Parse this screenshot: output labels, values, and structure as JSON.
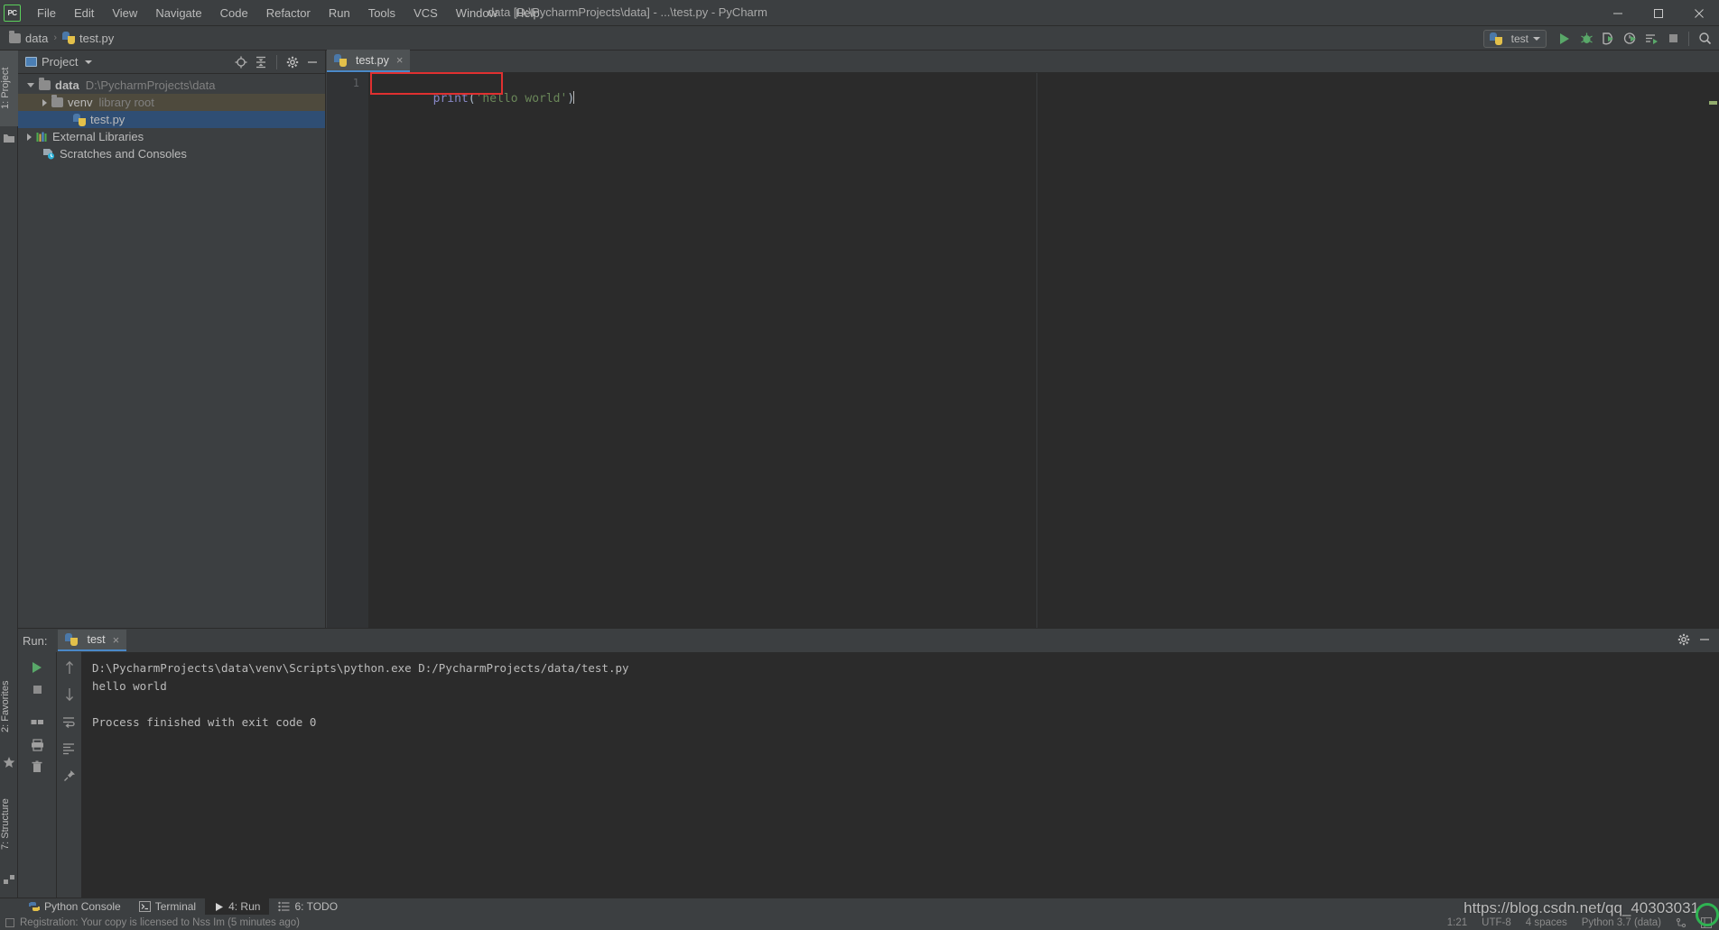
{
  "window": {
    "title": "data [D:\\PycharmProjects\\data] - ...\\test.py - PyCharm",
    "logo_text": "PC",
    "minimize": "—",
    "maximize": "❐",
    "close": "✕"
  },
  "menubar": {
    "items": [
      {
        "label": "File",
        "mnemonic": "F"
      },
      {
        "label": "Edit",
        "mnemonic": "E"
      },
      {
        "label": "View",
        "mnemonic": "V"
      },
      {
        "label": "Navigate",
        "mnemonic": "N"
      },
      {
        "label": "Code",
        "mnemonic": "C"
      },
      {
        "label": "Refactor",
        "mnemonic": "R"
      },
      {
        "label": "Run",
        "mnemonic": "u"
      },
      {
        "label": "Tools",
        "mnemonic": "T"
      },
      {
        "label": "VCS",
        "mnemonic": "S"
      },
      {
        "label": "Window",
        "mnemonic": "W"
      },
      {
        "label": "Help",
        "mnemonic": "H"
      }
    ]
  },
  "breadcrumb": {
    "root": "data",
    "separator": "›",
    "file": "test.py"
  },
  "run_widget": {
    "config_name": "test",
    "buttons": [
      "run-button",
      "debug-button",
      "run-coverage-button",
      "profile-button",
      "run-with-console-button",
      "stop-button",
      "search-button"
    ]
  },
  "left_strip": {
    "tabs": [
      {
        "label": "1: Project",
        "selected": true
      },
      {
        "label": "2: Favorites",
        "selected": false
      },
      {
        "label": "7: Structure",
        "selected": false
      }
    ]
  },
  "project_panel": {
    "title": "Project",
    "header_icons": [
      "locate-icon",
      "collapse-all-icon",
      "settings-icon",
      "hide-icon"
    ],
    "tree": [
      {
        "name": "data",
        "detail": "D:\\PycharmProjects\\data",
        "arrow": "down",
        "icon": "folder-icon",
        "bold": true,
        "indent": 0,
        "highlight": "none"
      },
      {
        "name": "venv",
        "detail": "library root",
        "arrow": "right",
        "icon": "folder-excluded-icon",
        "bold": false,
        "indent": 1,
        "highlight": "olive"
      },
      {
        "name": "test.py",
        "detail": "",
        "arrow": "none",
        "icon": "python-file-icon",
        "bold": false,
        "indent": 2,
        "highlight": "blue"
      },
      {
        "name": "External Libraries",
        "detail": "",
        "arrow": "right",
        "icon": "libraries-icon",
        "bold": false,
        "indent": 0,
        "highlight": "none"
      },
      {
        "name": "Scratches and Consoles",
        "detail": "",
        "arrow": "none",
        "icon": "scratches-icon",
        "bold": false,
        "indent": 0,
        "highlight": "none"
      }
    ]
  },
  "editor": {
    "tab_label": "test.py",
    "tab_close": "×",
    "line_number": "1",
    "code": {
      "fn": "print",
      "open_paren": "(",
      "string": "'hello world'",
      "close_paren": ")"
    },
    "annotation": "red-highlight-box"
  },
  "run_tool": {
    "label": "Run:",
    "tab_name": "test",
    "tab_close": "×",
    "header_icons": [
      "settings-icon",
      "hide-icon"
    ],
    "sidebar_icons": [
      "rerun-icon",
      "stop-icon",
      "layout-icon",
      "print-icon",
      "trash-icon",
      "up-arrow-icon",
      "down-arrow-icon",
      "soft-wrap-icon",
      "scroll-to-end-icon",
      "pin-icon"
    ],
    "console_lines": [
      "D:\\PycharmProjects\\data\\venv\\Scripts\\python.exe D:/PycharmProjects/data/test.py",
      "hello world",
      "",
      "Process finished with exit code 0"
    ]
  },
  "bottom_bar": {
    "tabs": [
      {
        "label": "Python Console",
        "mnemonic": "",
        "icon": "python-console-icon",
        "active": false
      },
      {
        "label": "Terminal",
        "mnemonic": "",
        "icon": "terminal-icon",
        "active": false
      },
      {
        "label": "4: Run",
        "mnemonic": "4",
        "icon": "run-icon",
        "active": true
      },
      {
        "label": "6: TODO",
        "mnemonic": "6",
        "icon": "todo-icon",
        "active": false
      }
    ]
  },
  "status_bar": {
    "message": "Registration: Your copy is licensed to Nss Im (5 minutes ago)",
    "caret_position": "1:21",
    "encoding": "UTF-8",
    "indent": "4 spaces",
    "interpreter": "Python 3.7 (data)"
  },
  "watermark": {
    "text": "https://blog.csdn.net/qq_40303031"
  },
  "colors": {
    "background": "#3c3f41",
    "editor_bg": "#2b2b2b",
    "accent_blue": "#4a88c7",
    "selection_blue": "#2f4e74",
    "selection_olive": "#4e4a3d",
    "run_green": "#59a869",
    "string_green": "#6a8759",
    "keyword_purple": "#8888c6",
    "annotation_red": "#e03030"
  }
}
